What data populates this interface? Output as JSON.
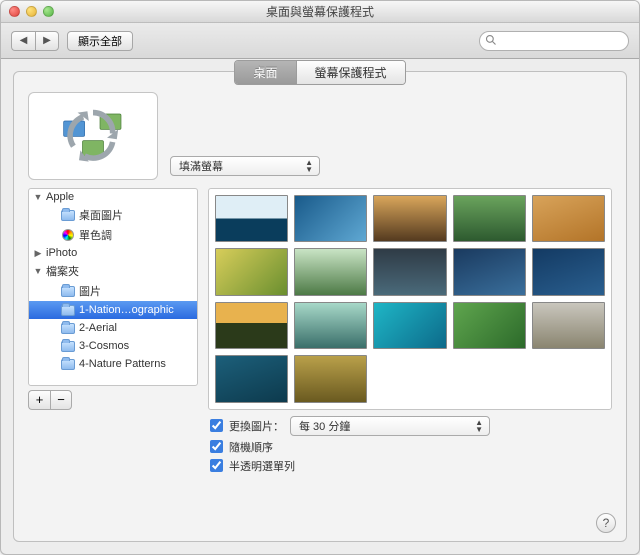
{
  "window": {
    "title": "桌面與螢幕保護程式"
  },
  "toolbar": {
    "back_label": "◀",
    "forward_label": "▶",
    "showall_label": "顯示全部",
    "search_placeholder": ""
  },
  "tabs": {
    "desktop": "桌面",
    "screensaver": "螢幕保護程式"
  },
  "fit": {
    "selected": "填滿螢幕"
  },
  "sidebar": {
    "groups": [
      {
        "label": "Apple",
        "expanded": true,
        "children": [
          {
            "label": "桌面圖片",
            "icon": "folder"
          },
          {
            "label": "單色調",
            "icon": "color"
          }
        ]
      },
      {
        "label": "iPhoto",
        "expanded": false,
        "children": []
      },
      {
        "label": "檔案夾",
        "expanded": true,
        "children": [
          {
            "label": "圖片",
            "icon": "folder"
          },
          {
            "label": "1-Nation…ographic",
            "icon": "folder",
            "selected": true
          },
          {
            "label": "2-Aerial",
            "icon": "folder"
          },
          {
            "label": "3-Cosmos",
            "icon": "folder"
          },
          {
            "label": "4-Nature Patterns",
            "icon": "folder"
          }
        ]
      }
    ],
    "add_label": "+",
    "remove_label": "−"
  },
  "thumbnails": [
    {
      "g": "linear-gradient(180deg,#dfeef6 50%,#0a3d5c 50%)"
    },
    {
      "g": "linear-gradient(135deg,#195a8a,#5fa8d3)"
    },
    {
      "g": "linear-gradient(180deg,#d9a65b,#543a1f)"
    },
    {
      "g": "linear-gradient(180deg,#6aa35d,#2d5a2f)"
    },
    {
      "g": "linear-gradient(160deg,#d8a35a,#b37428)"
    },
    {
      "g": "linear-gradient(135deg,#d7cd5a,#6a8f2f)"
    },
    {
      "g": "linear-gradient(180deg,#c9e4c5,#4d7a46)"
    },
    {
      "g": "linear-gradient(180deg,#2f3b46,#4a6a7a)"
    },
    {
      "g": "linear-gradient(160deg,#1a3a5f,#3a6f9c)"
    },
    {
      "g": "linear-gradient(160deg,#133a63,#2a5f8f)"
    },
    {
      "g": "linear-gradient(180deg,#e8b24e 45%,#2b3a1a 45%)"
    },
    {
      "g": "linear-gradient(180deg,#a7d8c8,#3a6f6a)"
    },
    {
      "g": "linear-gradient(135deg,#1fb6c6,#0c6a8a)"
    },
    {
      "g": "linear-gradient(135deg,#5fa54e,#2c6a2a)"
    },
    {
      "g": "linear-gradient(180deg,#c9c6bd,#8a8570)"
    },
    {
      "g": "linear-gradient(160deg,#1c5f7a,#0d3a4d)"
    },
    {
      "g": "linear-gradient(180deg,#b9a04a,#6a5a20)"
    }
  ],
  "options": {
    "change_label": "更換圖片：",
    "change_interval": "每 30 分鐘",
    "random_label": "隨機順序",
    "translucent_label": "半透明選單列",
    "change_checked": true,
    "random_checked": true,
    "translucent_checked": true
  },
  "help_label": "?"
}
